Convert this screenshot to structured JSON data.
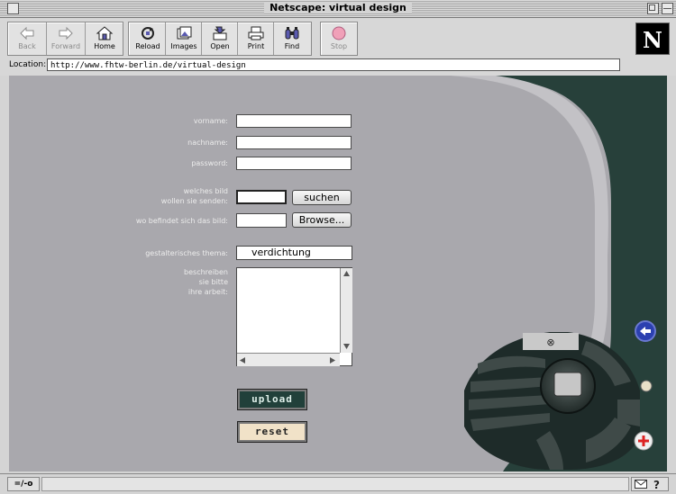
{
  "window": {
    "title": "Netscape: virtual design"
  },
  "toolbar": {
    "back": "Back",
    "forward": "Forward",
    "home": "Home",
    "reload": "Reload",
    "images": "Images",
    "open": "Open",
    "print": "Print",
    "find": "Find",
    "stop": "Stop"
  },
  "logo": {
    "letter": "N"
  },
  "location": {
    "label": "Location:",
    "url": "http://www.fhtw-berlin.de/virtual-design"
  },
  "form": {
    "vorname_label": "vorname:",
    "nachname_label": "nachname:",
    "password_label": "password:",
    "bild_label_1": "welches bild",
    "bild_label_2": "wollen sie senden:",
    "suchen_button": "suchen",
    "pfad_label": "wo befindet sich das bild:",
    "browse_button": "Browse...",
    "thema_label": "gestalterisches thema:",
    "thema_value": "verdichtung",
    "beschreiben_label_1": "beschreiben",
    "beschreiben_label_2": "sie bitte",
    "beschreiben_label_3": "ihre arbeit:",
    "upload_button": "upload",
    "reset_button": "reset"
  },
  "status": {
    "left": "=/-o"
  },
  "colors": {
    "content_bg": "#a9a8ad",
    "swirl_light": "#c6c6ca",
    "panel_dark": "#27403a",
    "upload_bg": "#21403a",
    "reset_bg": "#f1e2c8"
  },
  "icons": {
    "back": "left-arrow-icon",
    "forward": "right-arrow-icon",
    "home": "house-icon",
    "reload": "reload-icon",
    "images": "images-icon",
    "open": "open-icon",
    "print": "printer-icon",
    "find": "binoculars-icon",
    "stop": "stop-icon",
    "nav_back": "blue-back-arrow-icon",
    "nav_add": "red-plus-icon",
    "nav_close": "close-x-icon"
  }
}
